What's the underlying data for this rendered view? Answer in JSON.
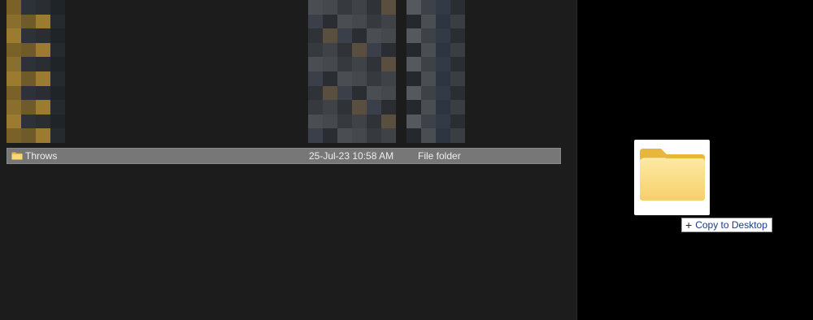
{
  "file_list": {
    "selected_row": {
      "name": "Throws",
      "date_modified": "25-Jul-23 10:58 AM",
      "type": "File folder",
      "icon": "folder-icon"
    }
  },
  "drag": {
    "icon": "folder-icon",
    "tooltip_action": "Copy to Desktop",
    "tooltip_icon": "plus-icon"
  },
  "colors": {
    "explorer_bg": "#1c1c1c",
    "selection_bg": "#777777",
    "desktop_bg": "#000000",
    "folder_yellow": "#f5d36b",
    "tooltip_text": "#1a3a8a"
  }
}
